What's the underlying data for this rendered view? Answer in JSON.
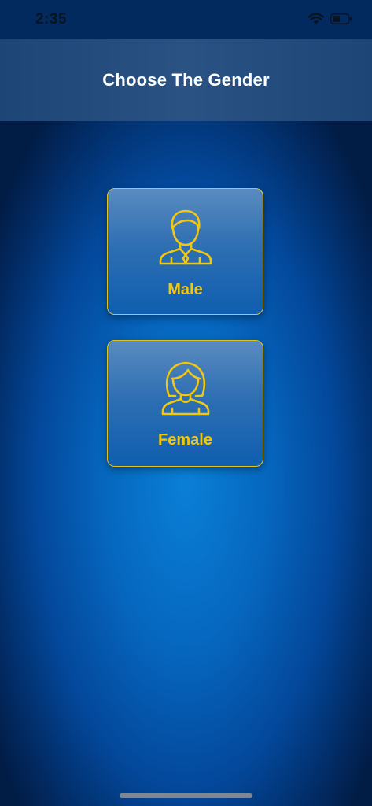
{
  "status_bar": {
    "time": "2:35",
    "icons": [
      "wifi-icon",
      "battery-icon"
    ]
  },
  "header": {
    "title": "Choose The Gender"
  },
  "options": [
    {
      "label": "Male",
      "icon": "male-avatar-icon"
    },
    {
      "label": "Female",
      "icon": "female-avatar-icon"
    }
  ],
  "colors": {
    "accent_yellow": "#f2c80f",
    "card_border": "#e1c21e",
    "header_bg": "#254d7d",
    "background_center": "#0a7fd6",
    "background_edge": "#011c45"
  }
}
